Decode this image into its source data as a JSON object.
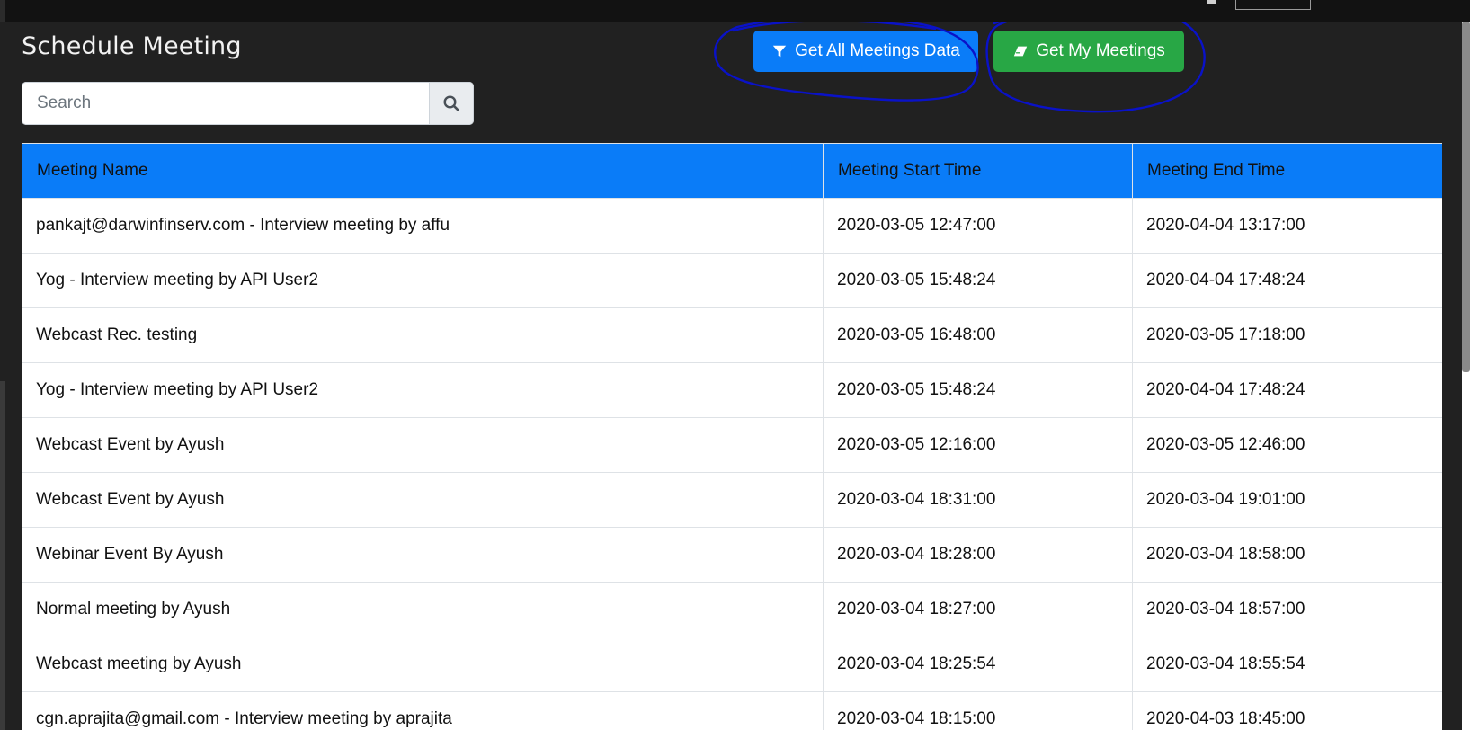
{
  "page": {
    "title": "Schedule Meeting"
  },
  "toolbar": {
    "all_meetings_label": "Get All Meetings Data",
    "all_meetings_icon": "filter-icon",
    "my_meetings_label": "Get My Meetings",
    "my_meetings_icon": "eraser-icon"
  },
  "search": {
    "value": "",
    "placeholder": "Search",
    "button_icon": "search-icon"
  },
  "table": {
    "columns": [
      "Meeting Name",
      "Meeting Start Time",
      "Meeting End Time"
    ],
    "rows": [
      [
        "pankajt@darwinfinserv.com - Interview meeting by affu",
        "2020-03-05 12:47:00",
        "2020-04-04 13:17:00"
      ],
      [
        "Yog - Interview meeting by API User2",
        "2020-03-05 15:48:24",
        "2020-04-04 17:48:24"
      ],
      [
        "Webcast Rec. testing",
        "2020-03-05 16:48:00",
        "2020-03-05 17:18:00"
      ],
      [
        "Yog - Interview meeting by API User2",
        "2020-03-05 15:48:24",
        "2020-04-04 17:48:24"
      ],
      [
        "Webcast Event by Ayush",
        "2020-03-05 12:16:00",
        "2020-03-05 12:46:00"
      ],
      [
        "Webcast Event by Ayush",
        "2020-03-04 18:31:00",
        "2020-03-04 19:01:00"
      ],
      [
        "Webinar Event By Ayush",
        "2020-03-04 18:28:00",
        "2020-03-04 18:58:00"
      ],
      [
        "Normal meeting by Ayush",
        "2020-03-04 18:27:00",
        "2020-03-04 18:57:00"
      ],
      [
        "Webcast meeting by Ayush",
        "2020-03-04 18:25:54",
        "2020-03-04 18:55:54"
      ],
      [
        "cgn.aprajita@gmail.com - Interview meeting by aprajita",
        "2020-03-04 18:15:00",
        "2020-04-03 18:45:00"
      ]
    ]
  },
  "colors": {
    "background": "#212121",
    "primary": "#0a7cf8",
    "success": "#28a745",
    "annotation_ink": "#0a12c8"
  }
}
